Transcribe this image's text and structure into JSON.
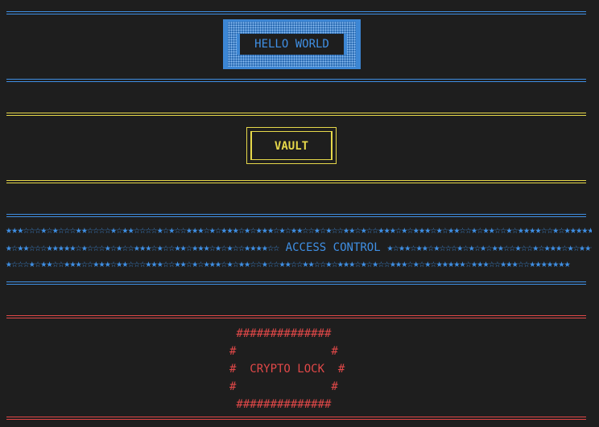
{
  "sections": {
    "hello": {
      "label": "HELLO WORLD",
      "color": "#3f8fe4"
    },
    "vault": {
      "label": "VAULT",
      "color": "#e6d84a"
    },
    "access": {
      "label": "ACCESS CONTROL",
      "color": "#3f8fe4",
      "top_stars": "★★★☆☆☆★☆★☆☆☆★★☆☆☆☆★☆★★☆☆☆☆★☆★☆☆★★★☆★☆★★★☆★☆★★★☆★☆★★☆☆★☆★☆☆★★☆★☆☆★★★☆★☆★★★☆★☆★★☆☆★☆★★☆☆★☆★★★★☆☆★☆★★★★★★★",
      "left_stars": "★☆★★☆☆☆★★★★★☆★☆☆☆★☆★☆☆★★★☆★☆☆★★☆★★★☆★☆★☆☆★★★★☆☆",
      "right_stars": "★☆★★☆★★☆★☆☆☆★☆★☆★☆★★☆☆★☆☆★☆★★★☆★☆★★☆☆★☆★★★★★★",
      "bottom_stars": "★☆☆☆★☆★★☆☆★★★☆☆★★★☆★★☆☆☆★★★☆☆★★☆★☆★★★☆★☆★★☆☆★☆☆★★☆☆★★☆☆★☆★★★☆★☆★☆☆★★★☆★☆★☆★★★★★☆★★★☆☆★★★☆☆★★★★★★★"
    },
    "crypto": {
      "label": "CRYPTO LOCK",
      "color": "#e04848",
      "lines": [
        " ##############",
        "#              #",
        "#  CRYPTO LOCK  #",
        "#              #",
        " ##############"
      ]
    }
  }
}
